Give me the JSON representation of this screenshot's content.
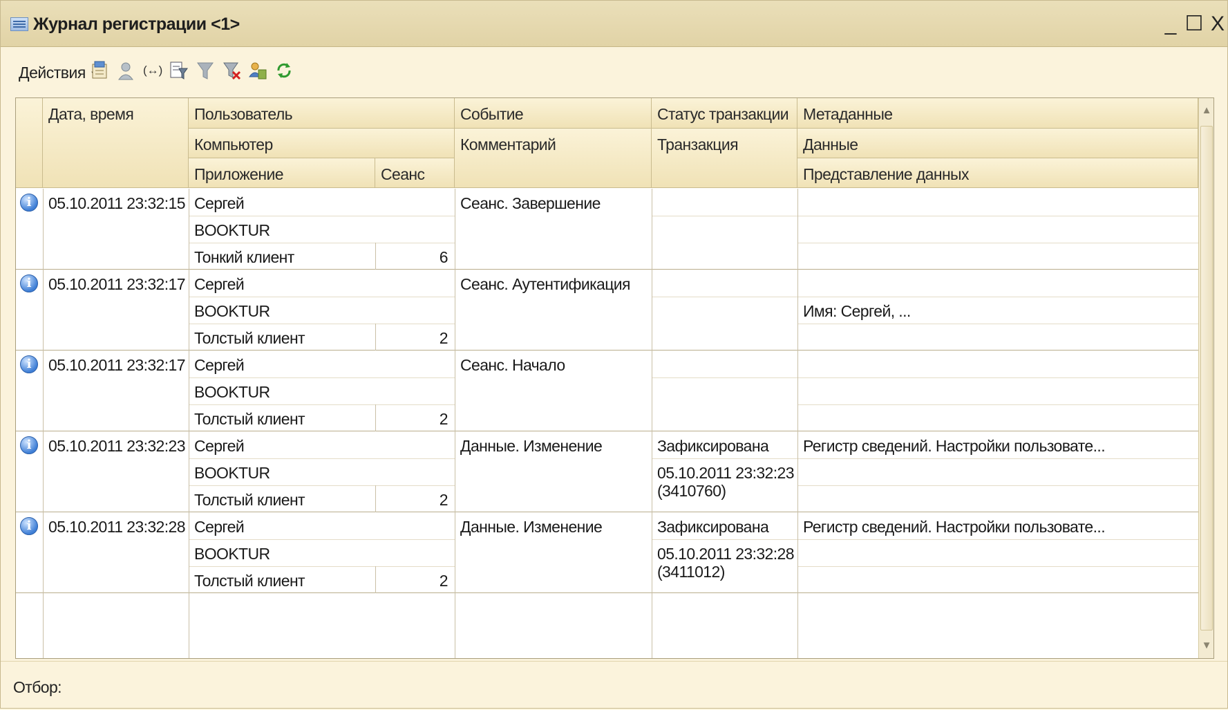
{
  "window": {
    "title": "Журнал регистрации <1>",
    "controls": {
      "minimize": "_",
      "maximize": "☐",
      "close": "X"
    }
  },
  "toolbar": {
    "actions_label": "Действия",
    "icons": [
      "open-event-icon",
      "user-info-icon",
      "interval-icon",
      "set-filter-icon",
      "filter-icon",
      "clear-filter-icon",
      "users-icon",
      "refresh-icon"
    ]
  },
  "grid": {
    "headers": {
      "date": "Дата, время",
      "user": "Пользователь",
      "event": "Событие",
      "status": "Статус транзакции",
      "metadata": "Метаданные",
      "computer": "Компьютер",
      "comment": "Комментарий",
      "transaction": "Транзакция",
      "data": "Данные",
      "application": "Приложение",
      "session": "Сеанс",
      "data_presentation": "Представление данных"
    },
    "rows": [
      {
        "date": "05.10.2011 23:32:15",
        "user": "Сергей",
        "computer": "BOOKTUR",
        "application": "Тонкий клиент",
        "session": "6",
        "event": "Сеанс. Завершение",
        "status": "",
        "transaction": "",
        "metadata": "",
        "data": ""
      },
      {
        "date": "05.10.2011 23:32:17",
        "user": "Сергей",
        "computer": "BOOKTUR",
        "application": "Толстый клиент",
        "session": "2",
        "event": "Сеанс. Аутентификация",
        "status": "",
        "transaction": "",
        "metadata": "",
        "data": "Имя: Сергей, ..."
      },
      {
        "date": "05.10.2011 23:32:17",
        "user": "Сергей",
        "computer": "BOOKTUR",
        "application": "Толстый клиент",
        "session": "2",
        "event": "Сеанс. Начало",
        "status": "",
        "transaction": "",
        "metadata": "",
        "data": ""
      },
      {
        "date": "05.10.2011 23:32:23",
        "user": "Сергей",
        "computer": "BOOKTUR",
        "application": "Толстый клиент",
        "session": "2",
        "event": "Данные. Изменение",
        "status": "Зафиксирована",
        "transaction": "05.10.2011 23:32:23",
        "transaction_id": "(3410760)",
        "metadata": "Регистр сведений. Настройки пользовате...",
        "data": ""
      },
      {
        "date": "05.10.2011 23:32:28",
        "user": "Сергей",
        "computer": "BOOKTUR",
        "application": "Толстый клиент",
        "session": "2",
        "event": "Данные. Изменение",
        "status": "Зафиксирована",
        "transaction": "05.10.2011 23:32:28",
        "transaction_id": "(3411012)",
        "metadata": "Регистр сведений. Настройки пользовате...",
        "data": ""
      }
    ]
  },
  "status": {
    "filter_label": "Отбор:"
  },
  "colors": {
    "background": "#fbf3dc",
    "header": "#f0e2b6",
    "info_icon": "#3f7fd6"
  }
}
